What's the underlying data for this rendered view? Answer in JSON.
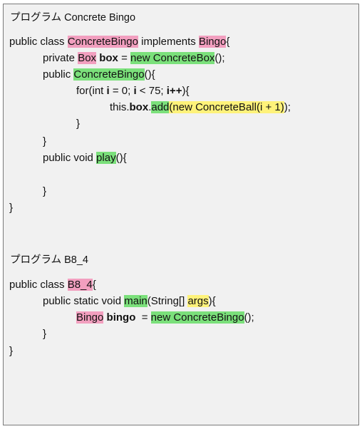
{
  "colors": {
    "pink": "#f29fbf",
    "green": "#7be07b",
    "yellow": "#fff27a",
    "panel": "#f1f1f1",
    "border": "#7a7a7a",
    "text": "#111111"
  },
  "sections": [
    {
      "title": "プログラム Concrete Bingo",
      "lines": [
        [
          {
            "t": "public class "
          },
          {
            "t": "ConcreteBingo",
            "h": "pink"
          },
          {
            "t": " implements "
          },
          {
            "t": "Bingo",
            "h": "pink"
          },
          {
            "t": "{"
          }
        ],
        [
          {
            "t": "private "
          },
          {
            "t": "Box",
            "h": "pink"
          },
          {
            "t": " "
          },
          {
            "t": "box",
            "b": true
          },
          {
            "t": " = "
          },
          {
            "t": "new ConcreteBox",
            "h": "green"
          },
          {
            "t": "();"
          }
        ],
        [
          {
            "t": "public "
          },
          {
            "t": "ConcreteBingo",
            "h": "green"
          },
          {
            "t": "(){"
          }
        ],
        [
          {
            "t": "for(int "
          },
          {
            "t": "i",
            "b": true
          },
          {
            "t": " = 0; "
          },
          {
            "t": "i",
            "b": true
          },
          {
            "t": " < 75; "
          },
          {
            "t": "i++",
            "b": true
          },
          {
            "t": "){"
          }
        ],
        [
          {
            "t": "this."
          },
          {
            "t": "box",
            "b": true
          },
          {
            "t": "."
          },
          {
            "t": "add",
            "h": "green"
          },
          {
            "t": "(new ConcreteBall(i + 1)",
            "h": "yellow"
          },
          {
            "t": ");"
          }
        ],
        [
          {
            "t": "}"
          }
        ],
        [
          {
            "t": "}"
          }
        ],
        [
          {
            "t": "public void "
          },
          {
            "t": "play",
            "h": "green"
          },
          {
            "t": "(){"
          }
        ],
        [],
        [
          {
            "t": "}"
          }
        ],
        [
          {
            "t": "}"
          }
        ]
      ]
    },
    {
      "title": "プログラム B8_4",
      "lines": [
        [
          {
            "t": "public class "
          },
          {
            "t": "B8_4",
            "h": "pink"
          },
          {
            "t": "{"
          }
        ],
        [
          {
            "t": "public static void "
          },
          {
            "t": "main",
            "h": "green"
          },
          {
            "t": "(String[] "
          },
          {
            "t": "args",
            "h": "yellow"
          },
          {
            "t": "){"
          }
        ],
        [
          {
            "t": "Bingo",
            "h": "pink"
          },
          {
            "t": " "
          },
          {
            "t": "bingo",
            "b": true
          },
          {
            "t": "  = "
          },
          {
            "t": "new ConcreteBingo",
            "h": "green"
          },
          {
            "t": "();"
          }
        ],
        [
          {
            "t": "}"
          }
        ],
        [
          {
            "t": "}"
          }
        ]
      ]
    }
  ]
}
